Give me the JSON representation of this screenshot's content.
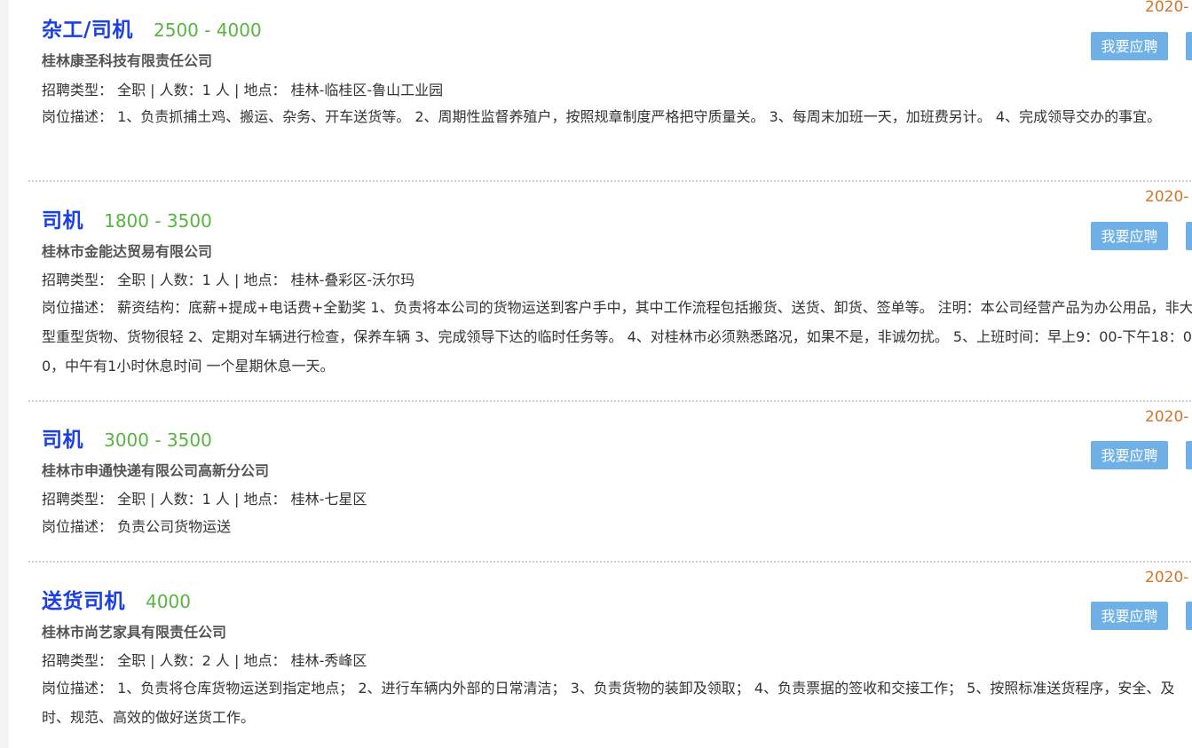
{
  "jobs": [
    {
      "title": "杂工/司机",
      "salary": "2500 - 4000",
      "company": "桂林康圣科技有限责任公司",
      "meta": "招聘类型： 全职 | 人数：1 人 | 地点： 桂林-临桂区-鲁山工业园",
      "description": "岗位描述： 1、负责抓捕土鸡、搬运、杂务、开车送货等。 2、周期性监督养殖户，按照规章制度严格把守质量关。 3、每周末加班一天，加班费另计。 4、完成领导交办的事宜。",
      "date": "2020-",
      "apply_label": "我要应聘"
    },
    {
      "title": "司机",
      "salary": "1800 - 3500",
      "company": "桂林市金能达贸易有限公司",
      "meta": "招聘类型： 全职 | 人数：1 人 | 地点： 桂林-叠彩区-沃尔玛",
      "description": "岗位描述： 薪资结构：底薪+提成+电话费+全勤奖 1、负责将本公司的货物运送到客户手中，其中工作流程包括搬货、送货、卸货、签单等。 注明：本公司经营产品为办公用品，非大型重型货物、货物很轻 2、定期对车辆进行检查，保养车辆 3、完成领导下达的临时任务等。 4、对桂林市必须熟悉路况，如果不是，非诚勿扰。 5、上班时间：早上9：00-下午18：00，中午有1小时休息时间 一个星期休息一天。",
      "date": "2020-",
      "apply_label": "我要应聘"
    },
    {
      "title": "司机",
      "salary": "3000 - 3500",
      "company": "桂林市申通快递有限公司高新分公司",
      "meta": "招聘类型： 全职 | 人数：1 人 | 地点： 桂林-七星区",
      "description": "岗位描述： 负责公司货物运送",
      "date": "2020-",
      "apply_label": "我要应聘"
    },
    {
      "title": "送货司机",
      "salary": "4000",
      "company": "桂林市尚艺家具有限责任公司",
      "meta": "招聘类型： 全职 | 人数：2 人 | 地点： 桂林-秀峰区",
      "description": "岗位描述： 1、负责将仓库货物运送到指定地点； 2、进行车辆内外部的日常清洁； 3、负责货物的装卸及领取； 4、负责票据的签收和交接工作； 5、按照标准送货程序，安全、及时、规范、高效的做好送货工作。",
      "date": "2020-",
      "apply_label": "我要应聘"
    }
  ]
}
